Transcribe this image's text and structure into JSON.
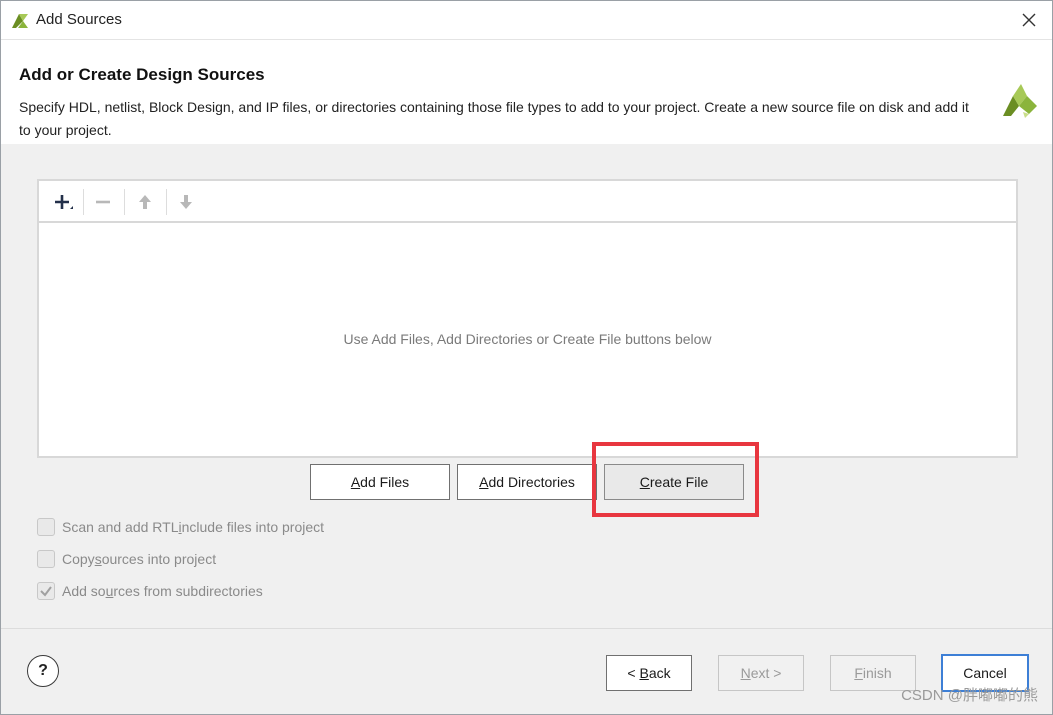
{
  "window": {
    "title": "Add Sources",
    "close_icon": "close-icon"
  },
  "header": {
    "title": "Add or Create Design Sources",
    "description": "Specify HDL, netlist, Block Design, and IP files, or directories containing those file types to add to your project. Create a new source file on disk and add it to your project."
  },
  "toolbar": {
    "icons": [
      "plus-icon",
      "minus-icon",
      "arrow-up-icon",
      "arrow-down-icon"
    ]
  },
  "file_panel": {
    "empty_message": "Use Add Files, Add Directories or Create File buttons below"
  },
  "buttons": {
    "add_files": {
      "accel": "A",
      "rest": "dd Files"
    },
    "add_directories": {
      "accel": "A",
      "rest": "dd Directories"
    },
    "create_file": {
      "accel": "C",
      "rest": "reate File"
    }
  },
  "options": [
    {
      "pre": "Scan and add RTL ",
      "accel": "i",
      "post": "nclude files into project",
      "checked": false
    },
    {
      "pre": "Copy ",
      "accel": "s",
      "post": "ources into project",
      "checked": false
    },
    {
      "pre": "Add so",
      "accel": "u",
      "post": "rces from subdirectories",
      "checked": true
    }
  ],
  "footer": {
    "help_label": "?",
    "back": {
      "pre": "< ",
      "accel": "B",
      "post": "ack"
    },
    "next": {
      "pre": "",
      "accel": "N",
      "post": "ext >"
    },
    "finish": {
      "pre": "",
      "accel": "F",
      "post": "inish"
    },
    "cancel": "Cancel"
  },
  "watermark": "CSDN @胖嘟嘟的熊",
  "colors": {
    "highlight": "#e8363f",
    "logo_green": "#8bb43c",
    "logo_dark": "#6b8e23",
    "primary_border": "#3d7fd6"
  }
}
